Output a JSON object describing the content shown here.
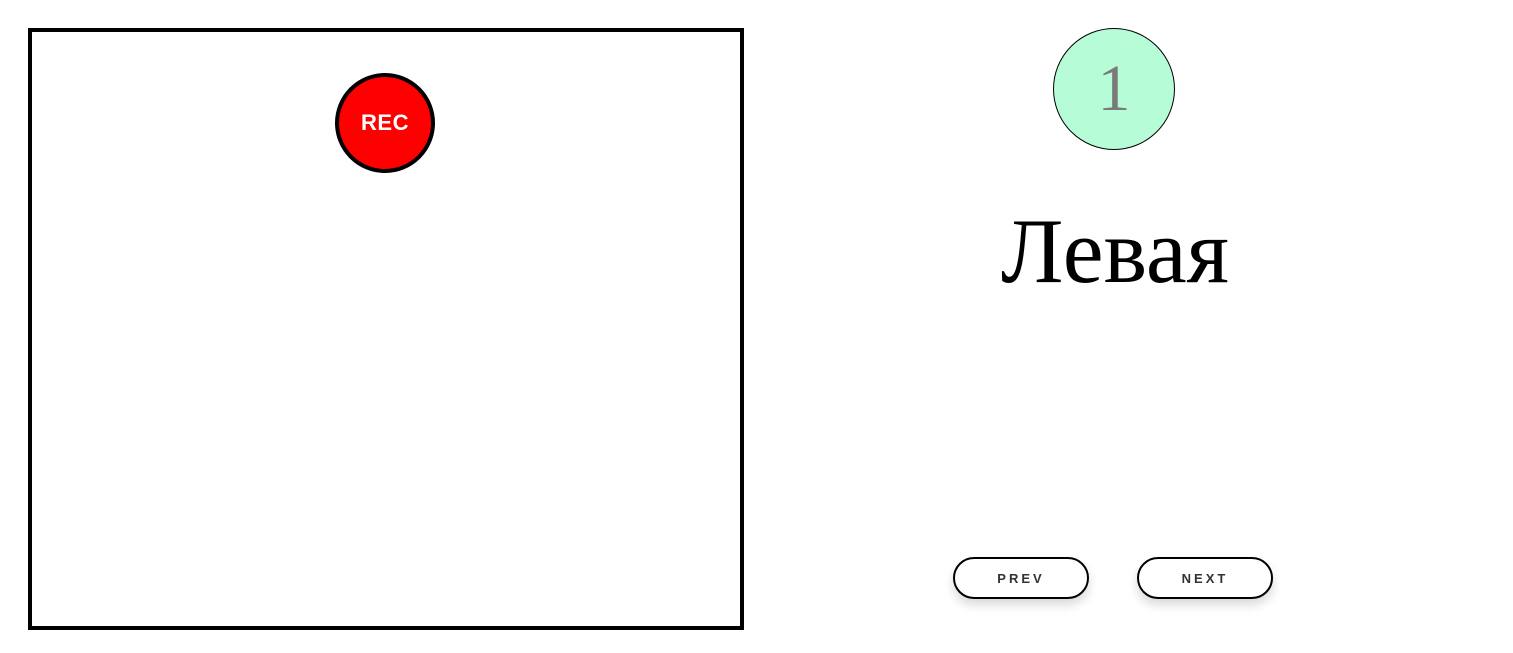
{
  "recorder": {
    "rec_label": "REC",
    "rec_color": "#ff0000",
    "frame_border_color": "#000000"
  },
  "card": {
    "step_number": "1",
    "step_circle_color": "#b5fcd7",
    "word": "Левая"
  },
  "nav": {
    "prev_label": "PREV",
    "next_label": "NEXT"
  }
}
